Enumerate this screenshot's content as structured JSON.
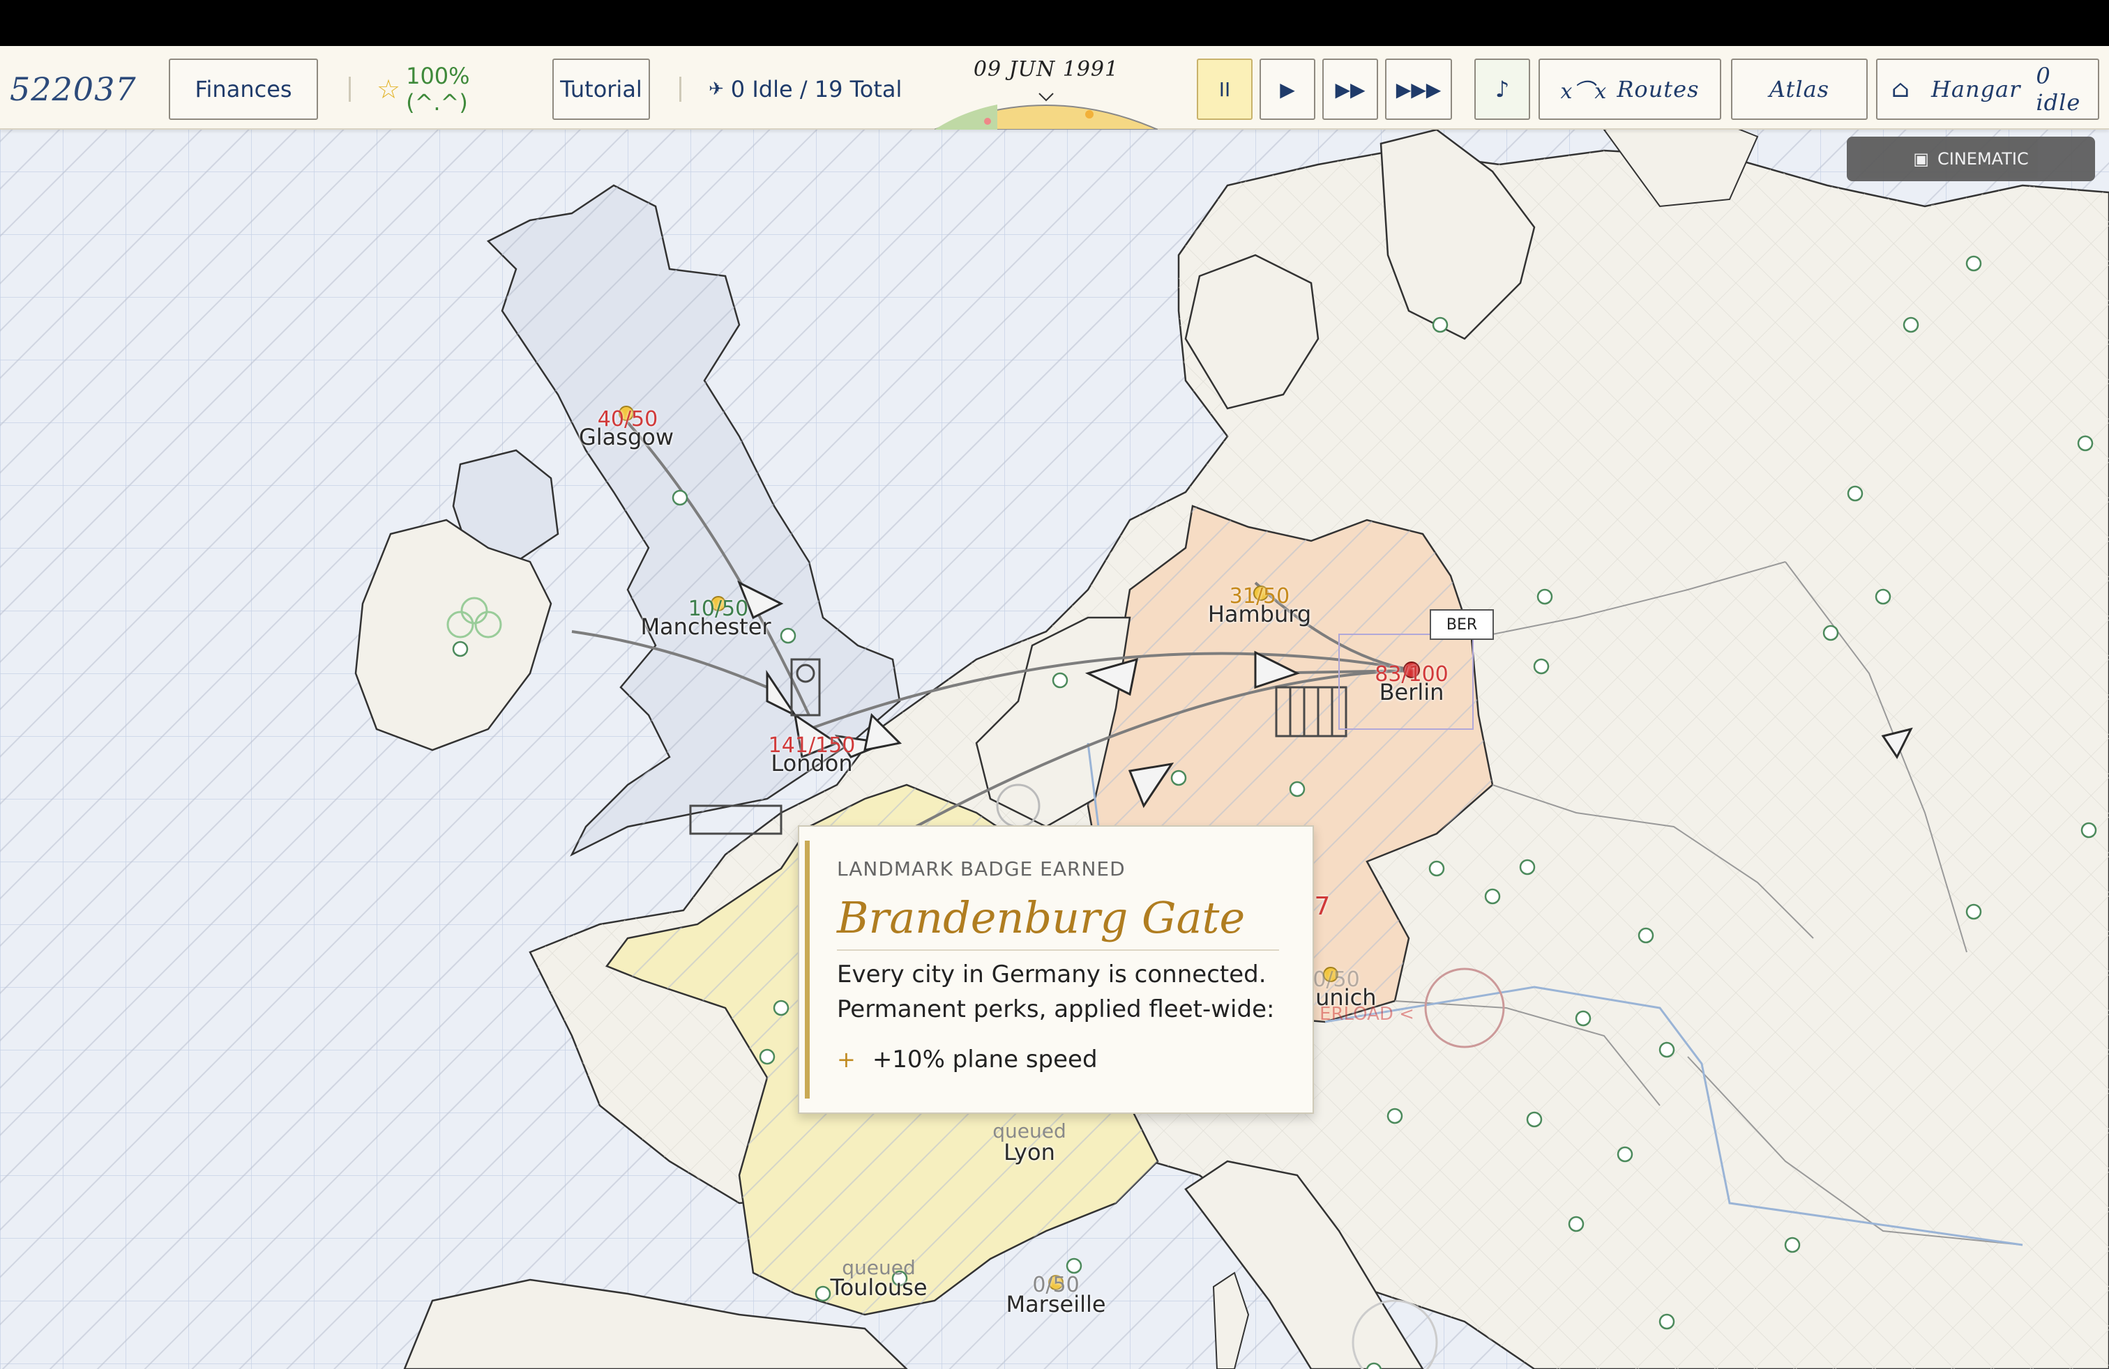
{
  "toolbar": {
    "money": "522037",
    "finances_label": "Finances",
    "rating_label": "100% (^.^)",
    "tutorial_label": "Tutorial",
    "fleet_label": "0 Idle / 19 Total",
    "date_label": "09 JUN 1991",
    "pause_label": "II",
    "play_label": "▶",
    "fast_label": "▶▶",
    "faster_label": "▶▶▶",
    "music_label": "♪",
    "routes_label": "Routes",
    "atlas_label": "Atlas",
    "hangar_label": "Hangar",
    "hangar_idle": "0 idle"
  },
  "map": {
    "cinematic_label": "CINEMATIC",
    "cities": [
      {
        "name": "Glasgow",
        "count": "40/50",
        "count_color": "red"
      },
      {
        "name": "Manchester",
        "count": "10/50",
        "count_color": "green"
      },
      {
        "name": "London",
        "count": "141/150",
        "count_color": "red"
      },
      {
        "name": "Hamburg",
        "count": "31/50",
        "count_color": "orange"
      },
      {
        "name": "Berlin",
        "count": "83/100",
        "count_color": "red"
      },
      {
        "name": "Munich",
        "count": "0/50",
        "count_color": "gray"
      },
      {
        "name": "Lyon",
        "status": "queued"
      },
      {
        "name": "Toulouse",
        "status": "queued"
      },
      {
        "name": "Marseille",
        "count": "0/50",
        "count_color": "gray"
      }
    ],
    "ber_tag": "BER",
    "munich_partial_count": "7",
    "overload_label": "ERLOAD <"
  },
  "badge_popup": {
    "kicker": "LANDMARK BADGE EARNED",
    "title": "Brandenburg Gate",
    "desc_line1": "Every city in Germany is connected.",
    "desc_line2": "Permanent perks, applied fleet-wide:",
    "perk_plus": "+",
    "perk": "+10% plane speed"
  },
  "colors": {
    "uk_fill": "#dfe4ee",
    "germany_fill": "#f6dcc4",
    "france_fill": "#f6efbf",
    "ocean": "#e9eef6",
    "land": "#f3f1ea",
    "route": "#7d7d7d",
    "accent_gold": "#b07d20"
  }
}
